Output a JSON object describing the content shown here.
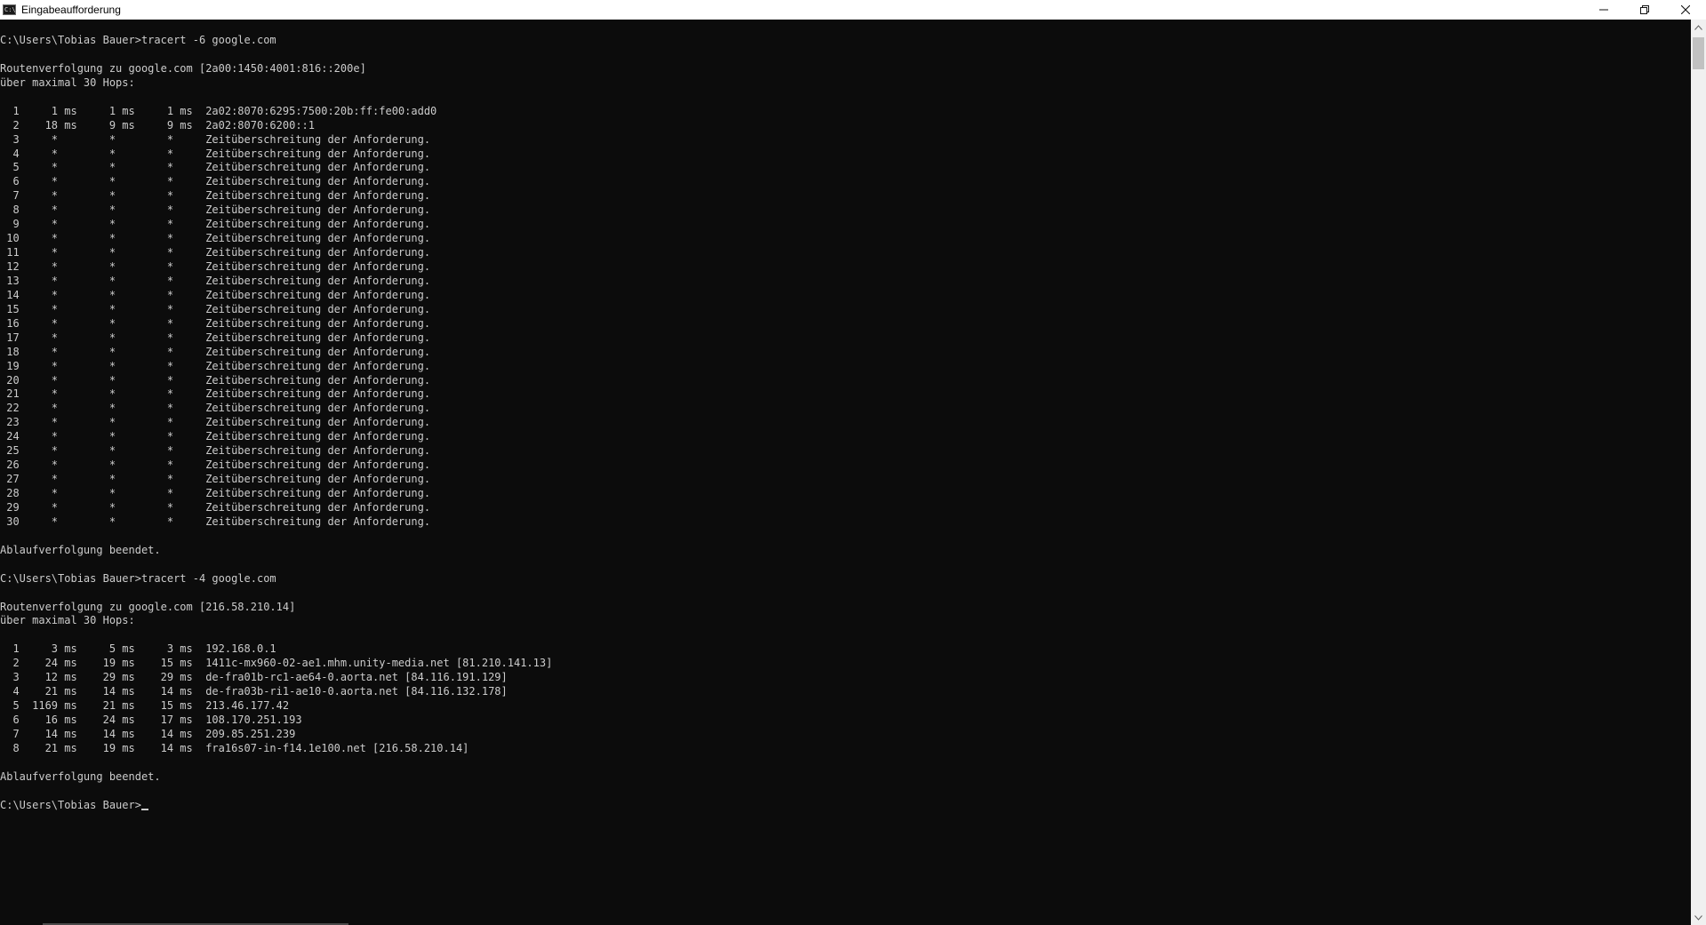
{
  "window": {
    "title": "Eingabeaufforderung",
    "icon": "cmd-icon",
    "icon_text": "C:\\.",
    "buttons": {
      "minimize": "minimize-icon",
      "maximize": "restore-icon",
      "close": "close-icon"
    }
  },
  "colors": {
    "background": "#0c0c0c",
    "foreground": "#cccccc",
    "titlebar": "#ffffff"
  },
  "console": {
    "lines": [
      "C:\\Users\\Tobias Bauer>tracert -6 google.com",
      "",
      "Routenverfolgung zu google.com [2a00:1450:4001:816::200e]",
      "über maximal 30 Hops:",
      "",
      "  1     1 ms     1 ms     1 ms  2a02:8070:6295:7500:20b:ff:fe00:add0",
      "  2    18 ms     9 ms     9 ms  2a02:8070:6200::1",
      "  3     *        *        *     Zeitüberschreitung der Anforderung.",
      "  4     *        *        *     Zeitüberschreitung der Anforderung.",
      "  5     *        *        *     Zeitüberschreitung der Anforderung.",
      "  6     *        *        *     Zeitüberschreitung der Anforderung.",
      "  7     *        *        *     Zeitüberschreitung der Anforderung.",
      "  8     *        *        *     Zeitüberschreitung der Anforderung.",
      "  9     *        *        *     Zeitüberschreitung der Anforderung.",
      " 10     *        *        *     Zeitüberschreitung der Anforderung.",
      " 11     *        *        *     Zeitüberschreitung der Anforderung.",
      " 12     *        *        *     Zeitüberschreitung der Anforderung.",
      " 13     *        *        *     Zeitüberschreitung der Anforderung.",
      " 14     *        *        *     Zeitüberschreitung der Anforderung.",
      " 15     *        *        *     Zeitüberschreitung der Anforderung.",
      " 16     *        *        *     Zeitüberschreitung der Anforderung.",
      " 17     *        *        *     Zeitüberschreitung der Anforderung.",
      " 18     *        *        *     Zeitüberschreitung der Anforderung.",
      " 19     *        *        *     Zeitüberschreitung der Anforderung.",
      " 20     *        *        *     Zeitüberschreitung der Anforderung.",
      " 21     *        *        *     Zeitüberschreitung der Anforderung.",
      " 22     *        *        *     Zeitüberschreitung der Anforderung.",
      " 23     *        *        *     Zeitüberschreitung der Anforderung.",
      " 24     *        *        *     Zeitüberschreitung der Anforderung.",
      " 25     *        *        *     Zeitüberschreitung der Anforderung.",
      " 26     *        *        *     Zeitüberschreitung der Anforderung.",
      " 27     *        *        *     Zeitüberschreitung der Anforderung.",
      " 28     *        *        *     Zeitüberschreitung der Anforderung.",
      " 29     *        *        *     Zeitüberschreitung der Anforderung.",
      " 30     *        *        *     Zeitüberschreitung der Anforderung.",
      "",
      "Ablaufverfolgung beendet.",
      "",
      "C:\\Users\\Tobias Bauer>tracert -4 google.com",
      "",
      "Routenverfolgung zu google.com [216.58.210.14]",
      "über maximal 30 Hops:",
      "",
      "  1     3 ms     5 ms     3 ms  192.168.0.1",
      "  2    24 ms    19 ms    15 ms  1411c-mx960-02-ae1.mhm.unity-media.net [81.210.141.13]",
      "  3    12 ms    29 ms    29 ms  de-fra01b-rc1-ae64-0.aorta.net [84.116.191.129]",
      "  4    21 ms    14 ms    14 ms  de-fra03b-ri1-ae10-0.aorta.net [84.116.132.178]",
      "  5  1169 ms    21 ms    15 ms  213.46.177.42",
      "  6    16 ms    24 ms    17 ms  108.170.251.193",
      "  7    14 ms    14 ms    14 ms  209.85.251.239",
      "  8    21 ms    19 ms    14 ms  fra16s07-in-f14.1e100.net [216.58.210.14]",
      "",
      "Ablaufverfolgung beendet.",
      ""
    ],
    "prompt": "C:\\Users\\Tobias Bauer>"
  }
}
